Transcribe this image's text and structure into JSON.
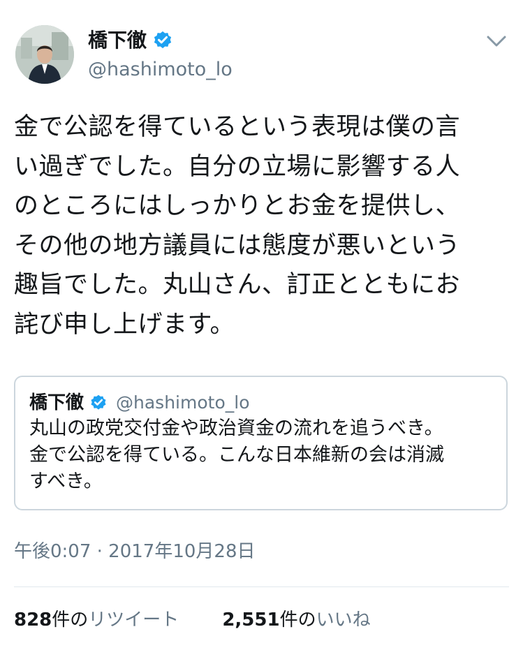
{
  "tweet": {
    "author_name": "橋下徹",
    "author_handle": "@hashimoto_lo",
    "avatar_icon": "person-avatar",
    "text": "金で公認を得ているという表現は僕の言\nい過ぎでした。自分の立場に影響する人\nのところにはしっかりとお金を提供し、\nその他の地方議員には態度が悪いという\n趣旨でした。丸山さん、訂正とともにお\n詫び申し上げます。",
    "timestamp": "午後0:07 · 2017年10月28日"
  },
  "quoted_tweet": {
    "author_name": "橋下徹",
    "author_handle": "@hashimoto_lo",
    "text": "丸山の政党交付金や政治資金の流れを追うべき。\n金で公認を得ている。こんな日本維新の会は消滅\nすべき。"
  },
  "stats": {
    "retweets_count": "828",
    "retweets_suffix": "件の",
    "retweets_label": "リツイート",
    "likes_count": "2,551",
    "likes_suffix": "件の",
    "likes_label": "いいね"
  },
  "colors": {
    "verified_blue": "#1da1f2",
    "secondary_text": "#657786",
    "border": "#ccd6dd"
  }
}
